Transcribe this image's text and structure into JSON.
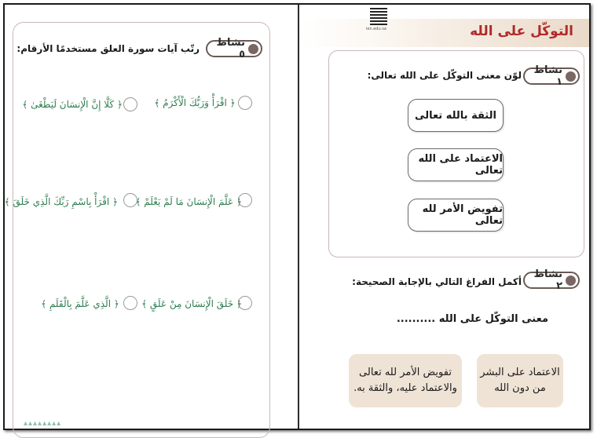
{
  "left_page": {
    "activity_badge": "نشاط ٥",
    "instruction": "رتّب آيات سورة العلق مستخدمًا الأرقام:",
    "verses": [
      {
        "text": "﴿ اقْرَأْ وَرَبُّكَ الْأَكْرَمُ ﴾"
      },
      {
        "text": "﴿ كَلَّا إِنَّ الْإِنسَانَ لَيَطْغَىٰ ﴾"
      },
      {
        "text": "﴿ عَلَّمَ الْإِنسَانَ مَا لَمْ يَعْلَمْ ﴾"
      },
      {
        "text": "﴿ اقْرَأْ بِاسْمِ رَبِّكَ الَّذِي خَلَقَ ﴾"
      },
      {
        "text": "﴿ خَلَقَ الْإِنسَانَ مِنْ عَلَقٍ ﴾"
      },
      {
        "text": "﴿ الَّذِي عَلَّمَ بِالْقَلَمِ ﴾"
      }
    ]
  },
  "right_page": {
    "title": "التوكّل على الله",
    "qr_caption": "ien.edu.sa",
    "activity1": {
      "badge": "نشاط ١",
      "instruction": "لوّن معنى التوكّل على الله تعالى:",
      "options": [
        "الثقة بالله تعالى",
        "الاعتماد على الله تعالى",
        "تفويض الأمر لله تعالى"
      ]
    },
    "activity2": {
      "badge": "نشاط ٢",
      "instruction": "أكمل الفراغ التالي بالإجابة الصحيحة:",
      "stem": "معنى التوكّل على الله ..........",
      "answers": [
        {
          "line1": "الاعتماد على البشر",
          "line2": "من دون الله"
        },
        {
          "line1": "تفويض الأمر لله تعالى",
          "line2": "والاعتماد عليه، والثقة به."
        }
      ]
    }
  },
  "colors": {
    "verse_green": "#2e7d4f",
    "title_red": "#b02a2a",
    "answer_fill": "#efe3d6",
    "badge_border": "#6b5a56"
  }
}
